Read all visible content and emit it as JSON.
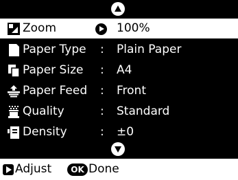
{
  "menu": {
    "items": [
      {
        "icon": "zoom-icon",
        "label": "Zoom",
        "separator": "",
        "value": "100%",
        "selected": true
      },
      {
        "icon": "paper-type-icon",
        "label": "Paper Type",
        "separator": ":",
        "value": "Plain Paper",
        "selected": false
      },
      {
        "icon": "paper-size-icon",
        "label": "Paper Size",
        "separator": ":",
        "value": "A4",
        "selected": false
      },
      {
        "icon": "paper-feed-icon",
        "label": "Paper Feed",
        "separator": ":",
        "value": "Front",
        "selected": false
      },
      {
        "icon": "quality-icon",
        "label": "Quality",
        "separator": ":",
        "value": "Standard",
        "selected": false
      },
      {
        "icon": "density-icon",
        "label": "Density",
        "separator": ":",
        "value": "±0",
        "selected": false
      }
    ]
  },
  "footer": {
    "adjust_label": "Adjust",
    "ok_badge": "OK",
    "done_label": "Done"
  },
  "colors": {
    "screen_bg": "#000000",
    "text": "#ffffff",
    "selection_bg": "#ffffff",
    "footer_bg": "#ffffff"
  }
}
